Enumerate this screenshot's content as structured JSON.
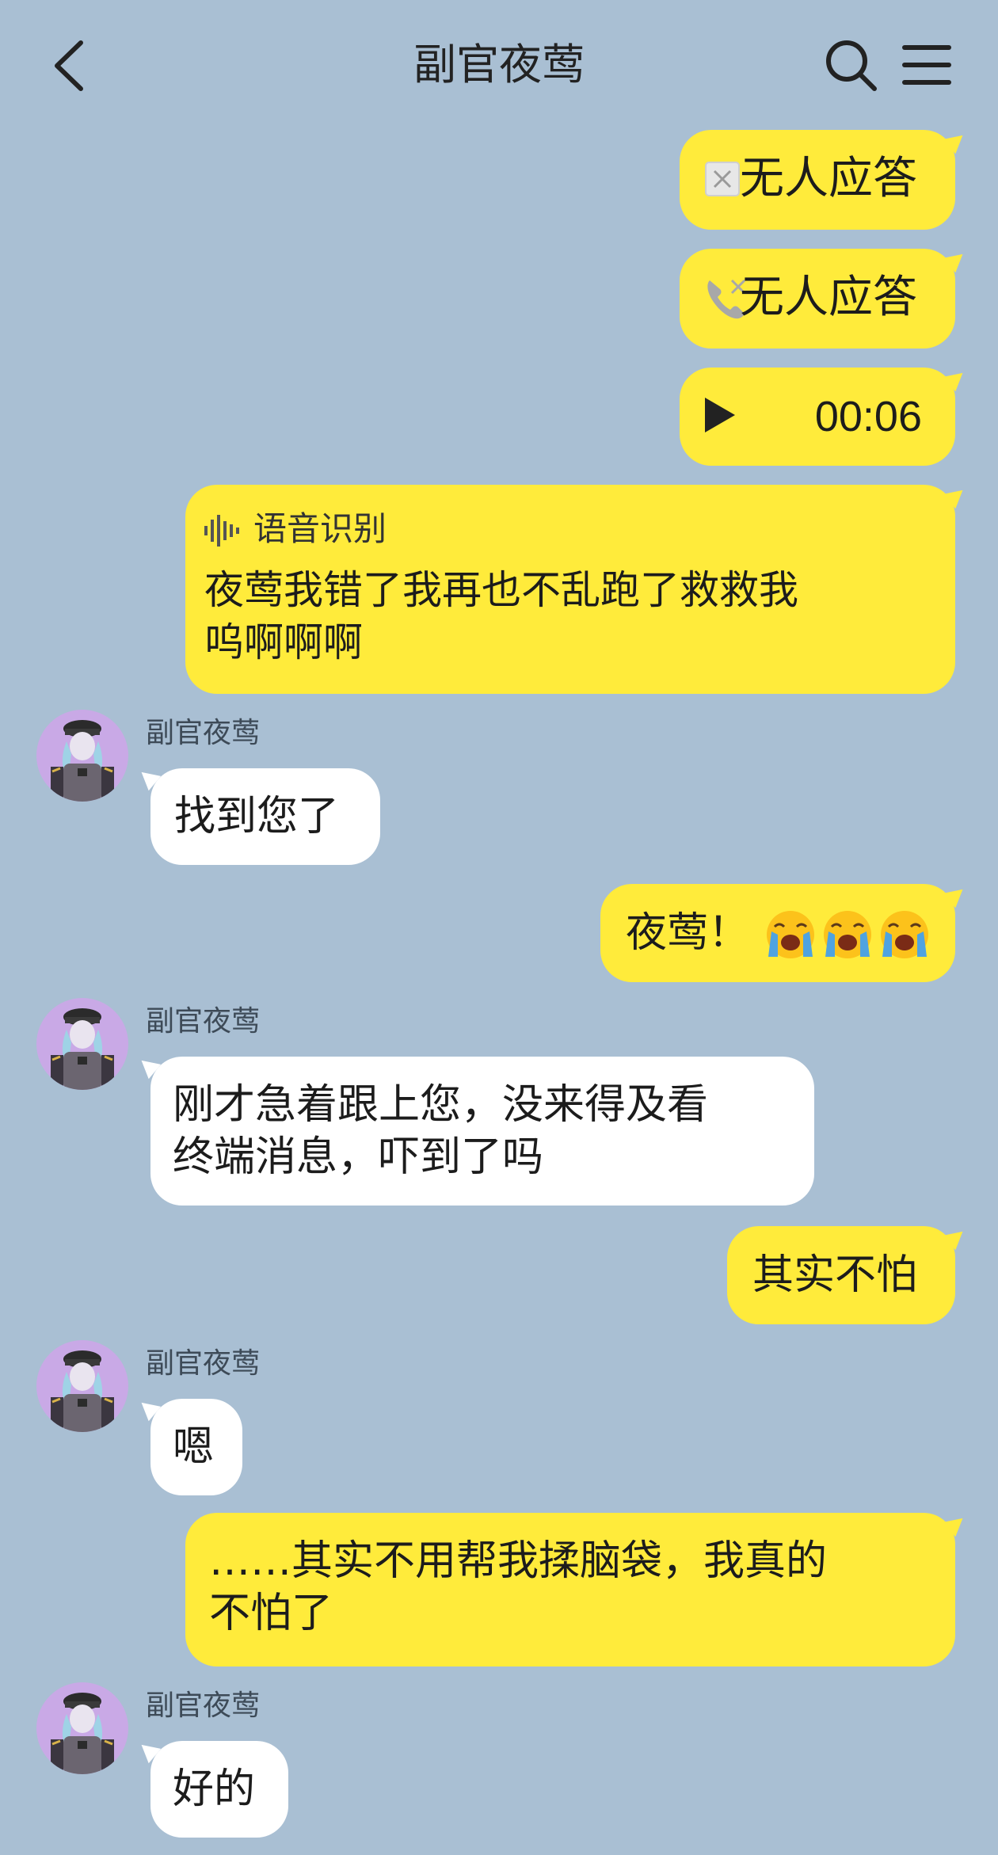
{
  "header": {
    "title": "副官夜莺"
  },
  "icons": {
    "back": "chevron-left-icon",
    "search": "search-icon",
    "menu": "hamburger-menu-icon",
    "video_call": "video-call-missed-icon",
    "voice_call": "phone-missed-icon",
    "play": "play-icon",
    "voice_wave": "sound-wave-icon",
    "emoji": "loudly-crying-face-emoji"
  },
  "colors": {
    "background": "#a9bfd3",
    "outgoing": "#ffeb3b",
    "incoming": "#ffffff",
    "avatar_bg": "#c9a9e6"
  },
  "messages": [
    {
      "dir": "out",
      "type": "video_call",
      "text": "无人应答"
    },
    {
      "dir": "out",
      "type": "voice_call",
      "text": "无人应答"
    },
    {
      "dir": "out",
      "type": "voice",
      "duration": "00:06"
    },
    {
      "dir": "out",
      "type": "voice_transcript",
      "label": "语音识别",
      "line1": "夜莺我错了我再也不乱跑了救救我",
      "line2": "呜啊啊啊"
    },
    {
      "dir": "in",
      "sender": "副官夜莺",
      "text": "找到您了"
    },
    {
      "dir": "out",
      "text": "夜莺！",
      "emoji_count": 3
    },
    {
      "dir": "in",
      "sender": "副官夜莺",
      "line1": "刚才急着跟上您，没来得及看",
      "line2": "终端消息，吓到了吗"
    },
    {
      "dir": "out",
      "text": "其实不怕"
    },
    {
      "dir": "in",
      "sender": "副官夜莺",
      "text": "嗯"
    },
    {
      "dir": "out",
      "line1": "……其实不用帮我揉脑袋，我真的",
      "line2": "不怕了"
    },
    {
      "dir": "in",
      "sender": "副官夜莺",
      "text": "好的"
    }
  ]
}
